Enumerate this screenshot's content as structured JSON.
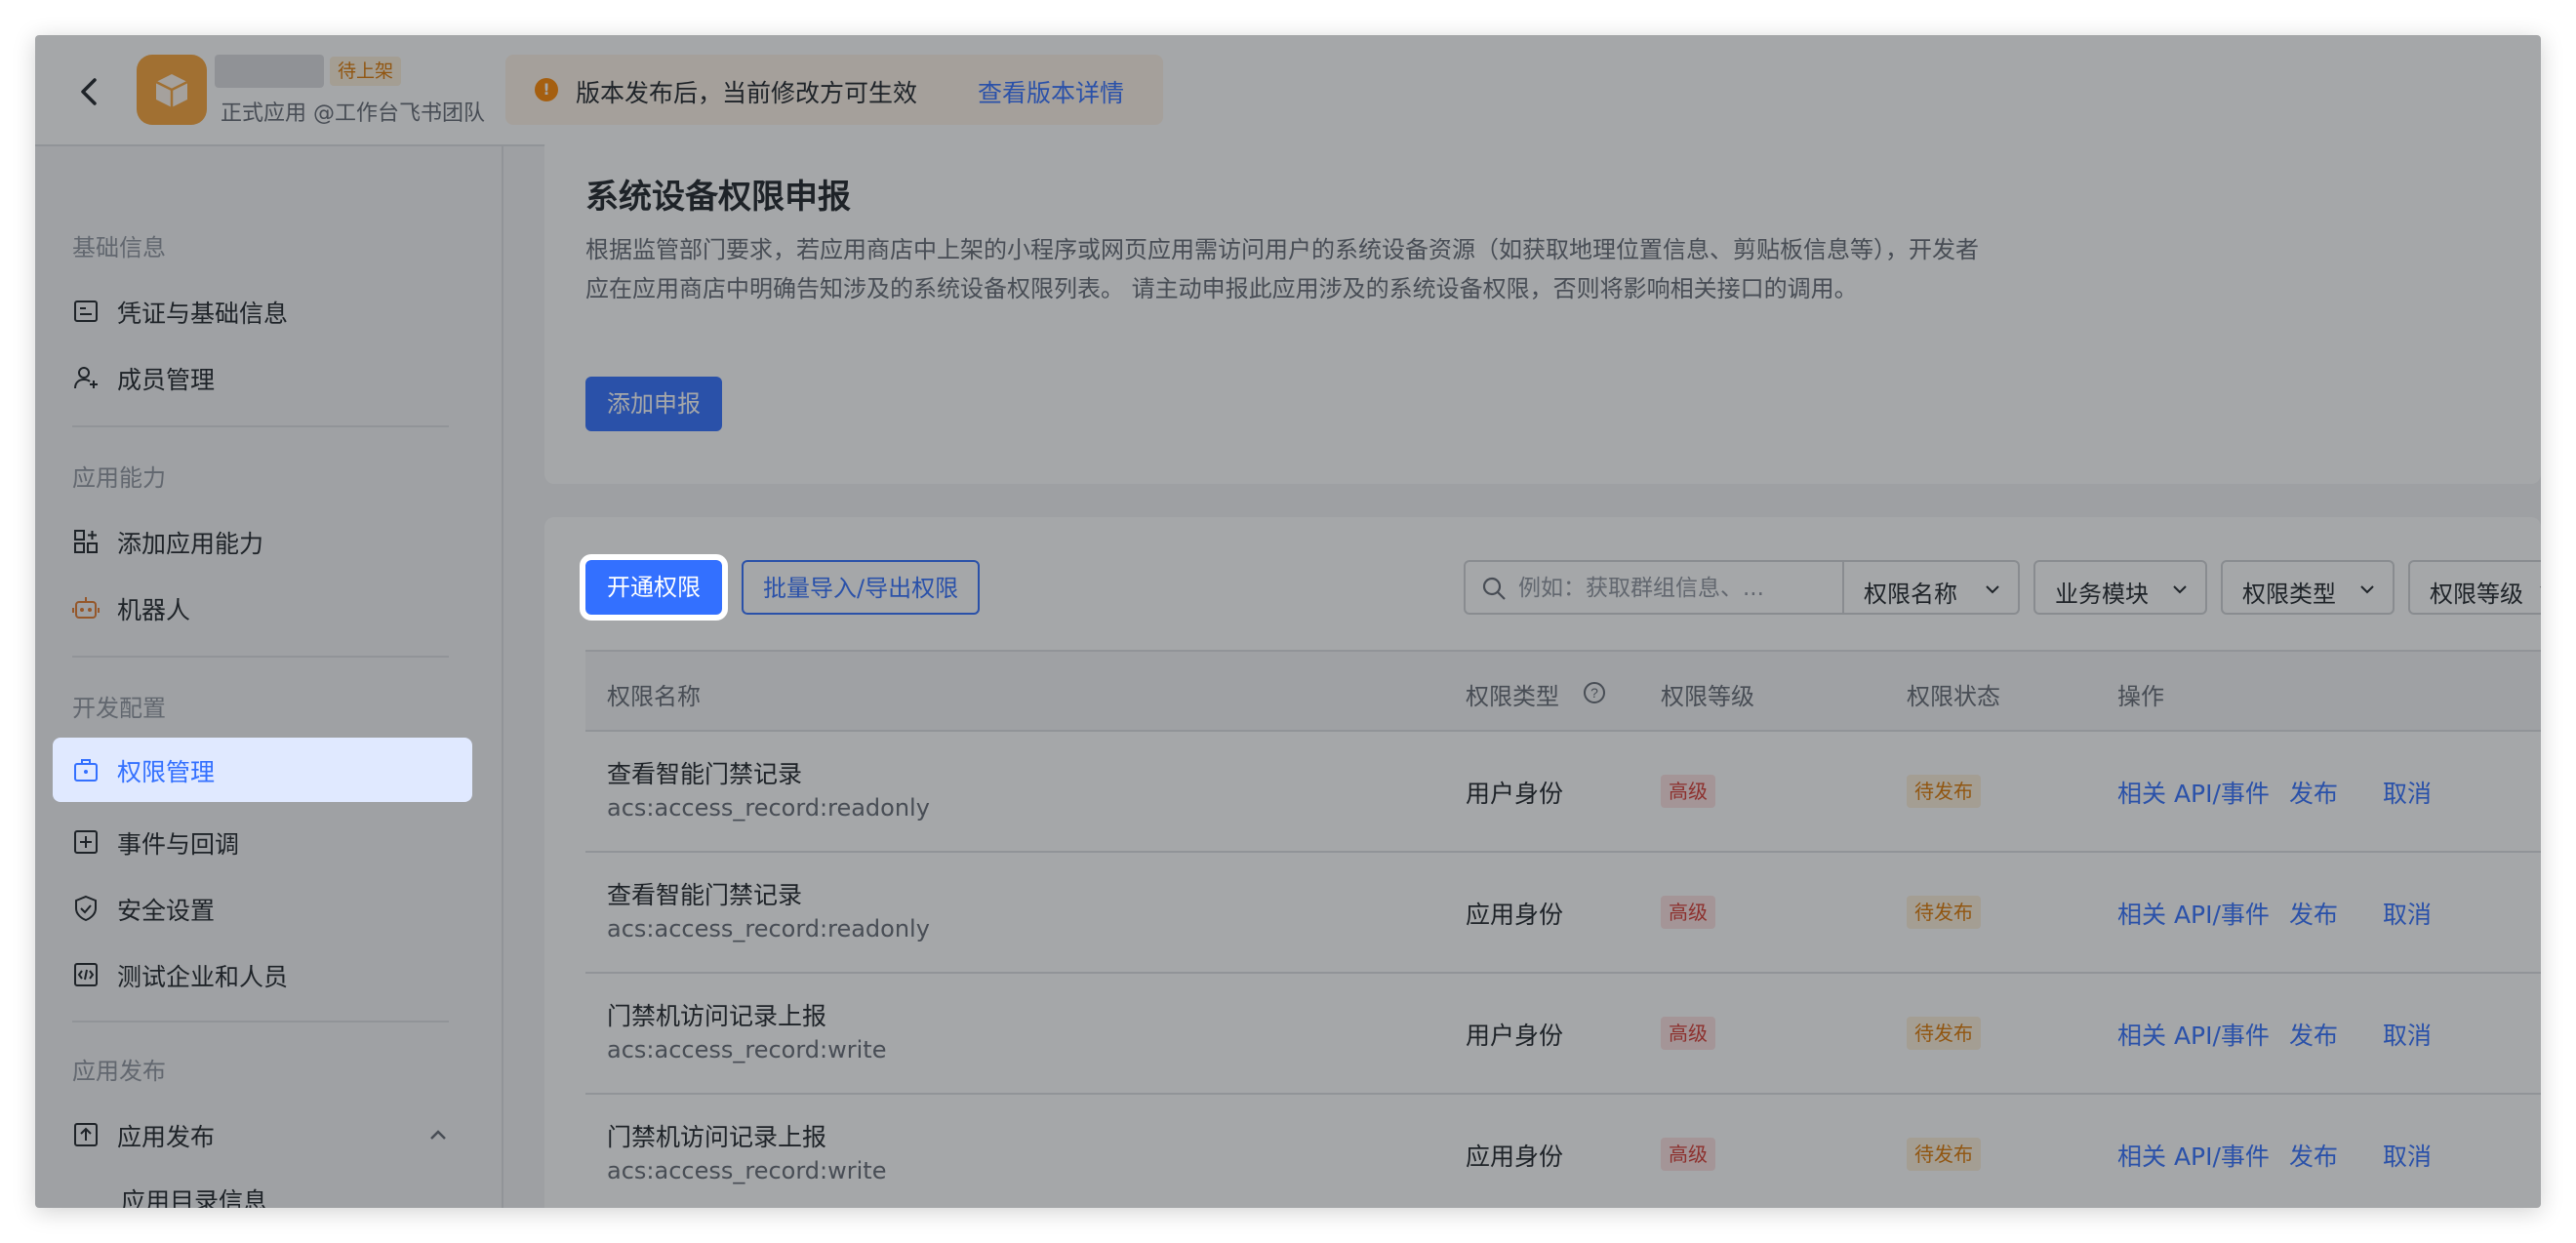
{
  "header": {
    "app_status_tag": "待上架",
    "app_subtitle": "正式应用 @工作台飞书团队",
    "notice_text": "版本发布后，当前修改方可生效",
    "notice_link": "查看版本详情"
  },
  "sidebar": {
    "groups": [
      "基础信息",
      "应用能力",
      "开发配置",
      "应用发布"
    ],
    "items": [
      {
        "label": "凭证与基础信息",
        "icon": "credential-icon"
      },
      {
        "label": "成员管理",
        "icon": "member-icon"
      },
      {
        "label": "添加应用能力",
        "icon": "apps-grid-icon"
      },
      {
        "label": "机器人",
        "icon": "robot-icon"
      },
      {
        "label": "权限管理",
        "icon": "permission-briefcase-icon",
        "active": true
      },
      {
        "label": "事件与回调",
        "icon": "event-icon"
      },
      {
        "label": "安全设置",
        "icon": "shield-icon"
      },
      {
        "label": "测试企业和人员",
        "icon": "code-icon"
      },
      {
        "label": "应用发布",
        "icon": "upload-icon"
      }
    ],
    "sub_items": [
      "应用目录信息"
    ]
  },
  "device_card": {
    "title": "系统设备权限申报",
    "description": "根据监管部门要求，若应用商店中上架的小程序或网页应用需访问用户的系统设备资源（如获取地理位置信息、剪贴板信息等），开发者应在应用商店中明确告知涉及的系统设备权限列表。 请主动申报此应用涉及的系统设备权限，否则将影响相关接口的调用。",
    "add_button": "添加申报"
  },
  "perm_card": {
    "open_button": "开通权限",
    "bulk_button": "批量导入/导出权限",
    "search_placeholder": "例如：获取群组信息、...",
    "filters": [
      "权限名称",
      "业务模块",
      "权限类型",
      "权限等级"
    ],
    "columns": [
      "权限名称",
      "权限类型",
      "权限等级",
      "权限状态",
      "操作"
    ],
    "rows": [
      {
        "name": "查看智能门禁记录",
        "key": "acs:access_record:readonly",
        "type": "用户身份",
        "level": "高级",
        "status": "待发布"
      },
      {
        "name": "查看智能门禁记录",
        "key": "acs:access_record:readonly",
        "type": "应用身份",
        "level": "高级",
        "status": "待发布"
      },
      {
        "name": "门禁机访问记录上报",
        "key": "acs:access_record:write",
        "type": "用户身份",
        "level": "高级",
        "status": "待发布"
      },
      {
        "name": "门禁机访问记录上报",
        "key": "acs:access_record:write",
        "type": "应用身份",
        "level": "高级",
        "status": "待发布"
      }
    ],
    "ops": [
      "相关 API/事件",
      "发布",
      "取消"
    ]
  },
  "colors": {
    "accent": "#3370ff",
    "warning": "#de7802",
    "danger": "#d83931",
    "app_logo": "#f8a43a"
  }
}
